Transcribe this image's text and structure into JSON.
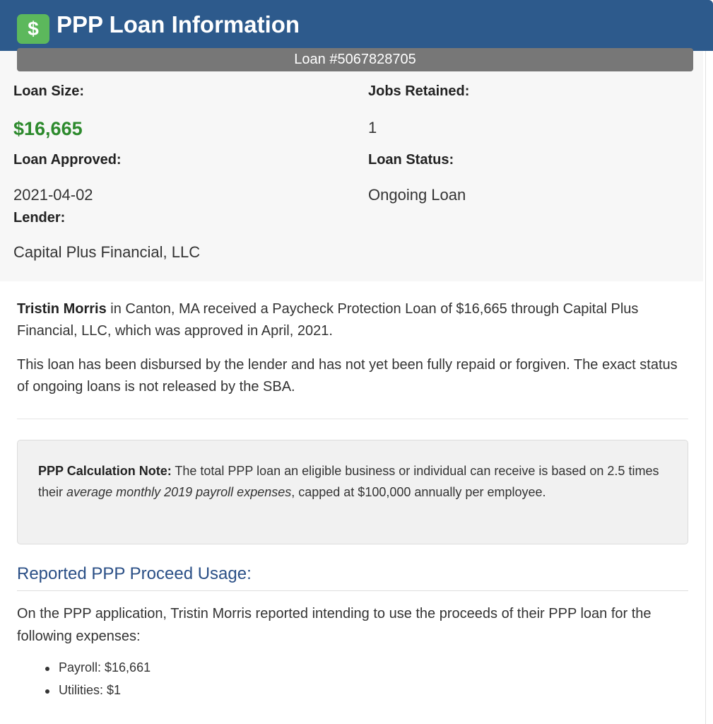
{
  "header": {
    "icon": "dollar-icon",
    "icon_glyph": "$",
    "title": "PPP Loan Information"
  },
  "loan": {
    "number": "Loan #5067828705",
    "size_label": "Loan Size:",
    "size_value": "$16,665",
    "jobs_label": "Jobs Retained:",
    "jobs_value": "1",
    "approved_label": "Loan Approved:",
    "approved_value": "2021-04-02",
    "status_label": "Loan Status:",
    "status_value": "Ongoing Loan",
    "lender_label": "Lender:",
    "lender_value": "Capital Plus Financial, LLC"
  },
  "summary": {
    "borrower": "Tristin Morris",
    "sentence_rest": " in Canton, MA received a Paycheck Protection Loan of $16,665 through Capital Plus Financial, LLC, which was approved in April, 2021.",
    "status_paragraph": "This loan has been disbursed by the lender and has not yet been fully repaid or forgiven. The exact status of ongoing loans is not released by the SBA."
  },
  "note": {
    "label": "PPP Calculation Note:",
    "text_before": " The total PPP loan an eligible business or individual can receive is based on 2.5 times their ",
    "emphasis": "average monthly 2019 payroll expenses",
    "text_after": ", capped at $100,000 annually per employee."
  },
  "usage": {
    "heading": "Reported PPP Proceed Usage:",
    "intro": "On the PPP application, Tristin Morris reported intending to use the proceeds of their PPP loan for the following expenses:",
    "items": [
      "Payroll: $16,661",
      "Utilities: $1"
    ]
  },
  "colors": {
    "header_bg": "#2d5a8c",
    "icon_bg": "#5cb85c",
    "loan_size_green": "#2d8a2d",
    "heading_blue": "#2a4f86",
    "loan_bar_gray": "#777777"
  }
}
